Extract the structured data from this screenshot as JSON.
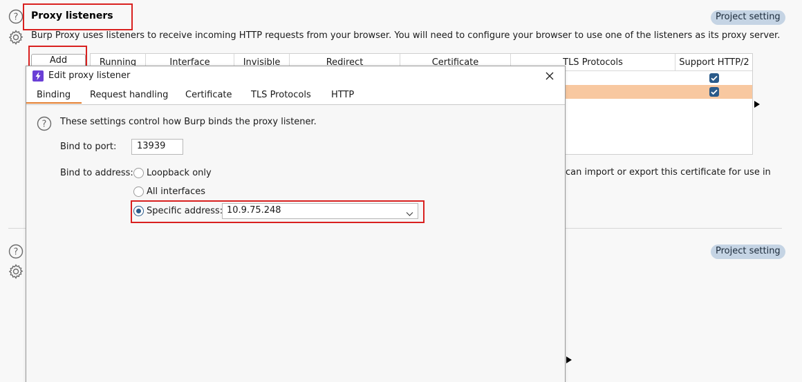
{
  "section1": {
    "title": "Proxy listeners",
    "badge": "Project setting",
    "description": "Burp Proxy uses listeners to receive incoming HTTP requests from your browser. You will need to configure your browser to use one of the listeners as its proxy server.",
    "add_button": "Add",
    "table": {
      "columns": [
        "Running",
        "Interface",
        "Invisible",
        "Redirect",
        "Certificate",
        "TLS Protocols",
        "Support HTTP/2"
      ],
      "rows": [
        {
          "support_http2": true,
          "selected": false
        },
        {
          "support_http2": true,
          "selected": true
        }
      ]
    },
    "cert_text_fragment": "can import or export this certificate for use in"
  },
  "section2": {
    "badge": "Project setting"
  },
  "dialog": {
    "title": "Edit proxy listener",
    "tabs": [
      "Binding",
      "Request handling",
      "Certificate",
      "TLS Protocols",
      "HTTP"
    ],
    "active_tab": "Binding",
    "intro": "These settings control how Burp binds the proxy listener.",
    "bind_port_label": "Bind to port:",
    "bind_port_value": "13939",
    "bind_address_label": "Bind to address:",
    "options": [
      {
        "label": "Loopback only",
        "selected": false
      },
      {
        "label": "All interfaces",
        "selected": false
      },
      {
        "label": "Specific address:",
        "selected": true
      }
    ],
    "specific_address_value": "10.9.75.248"
  },
  "colors": {
    "accent_tab_underline": "#e27c2d",
    "selected_row": "#f8c8a0",
    "highlight_box": "#d9201f",
    "checkbox": "#2b5b8a",
    "badge_bg": "#c5d4e4"
  }
}
